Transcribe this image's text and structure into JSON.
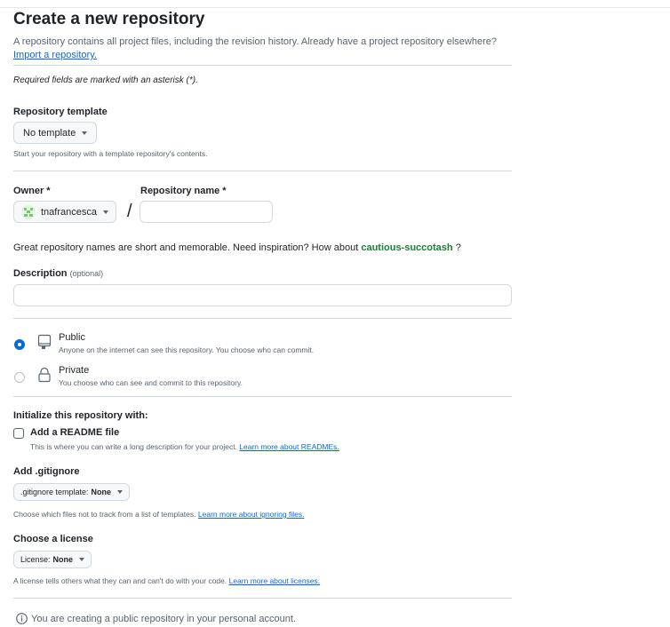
{
  "header": {
    "title": "Create a new repository",
    "intro": "A repository contains all project files, including the revision history. Already have a project repository elsewhere?",
    "import_link": "Import a repository.",
    "required_note": "Required fields are marked with an asterisk (*)."
  },
  "template": {
    "label": "Repository template",
    "value": "No template",
    "hint": "Start your repository with a template repository's contents."
  },
  "owner": {
    "label": "Owner *",
    "value": "tnafrancesca",
    "separator": "/"
  },
  "repo_name": {
    "label": "Repository name *",
    "value": ""
  },
  "name_suggestion": {
    "text": "Great repository names are short and memorable. Need inspiration? How about",
    "suggestion": "cautious-succotash",
    "suffix": "?"
  },
  "description": {
    "label": "Description",
    "optional": "(optional)",
    "value": ""
  },
  "visibility": {
    "public": {
      "title": "Public",
      "desc": "Anyone on the internet can see this repository. You choose who can commit.",
      "selected": true
    },
    "private": {
      "title": "Private",
      "desc": "You choose who can see and commit to this repository.",
      "selected": false
    }
  },
  "init": {
    "label": "Initialize this repository with:",
    "readme_label": "Add a README file",
    "readme_hint": "This is where you can write a long description for your project.",
    "readme_link": "Learn more about READMEs."
  },
  "gitignore": {
    "label": "Add .gitignore",
    "button_prefix": ".gitignore template:",
    "button_value": "None",
    "hint": "Choose which files not to track from a list of templates.",
    "link": "Learn more about ignoring files."
  },
  "license": {
    "label": "Choose a license",
    "button_prefix": "License:",
    "button_value": "None",
    "hint": "A license tells others what they can and can't do with your code.",
    "link": "Learn more about licenses."
  },
  "footer": {
    "notice": "You are creating a public repository in your personal account."
  },
  "colors": {
    "accent": "#0969da",
    "suggestion": "#1a7f37",
    "border": "#d1d9e0"
  },
  "icons": {
    "owner_avatar": "owner-avatar",
    "public": "repo-icon",
    "private": "lock-icon",
    "info": "info-icon"
  }
}
